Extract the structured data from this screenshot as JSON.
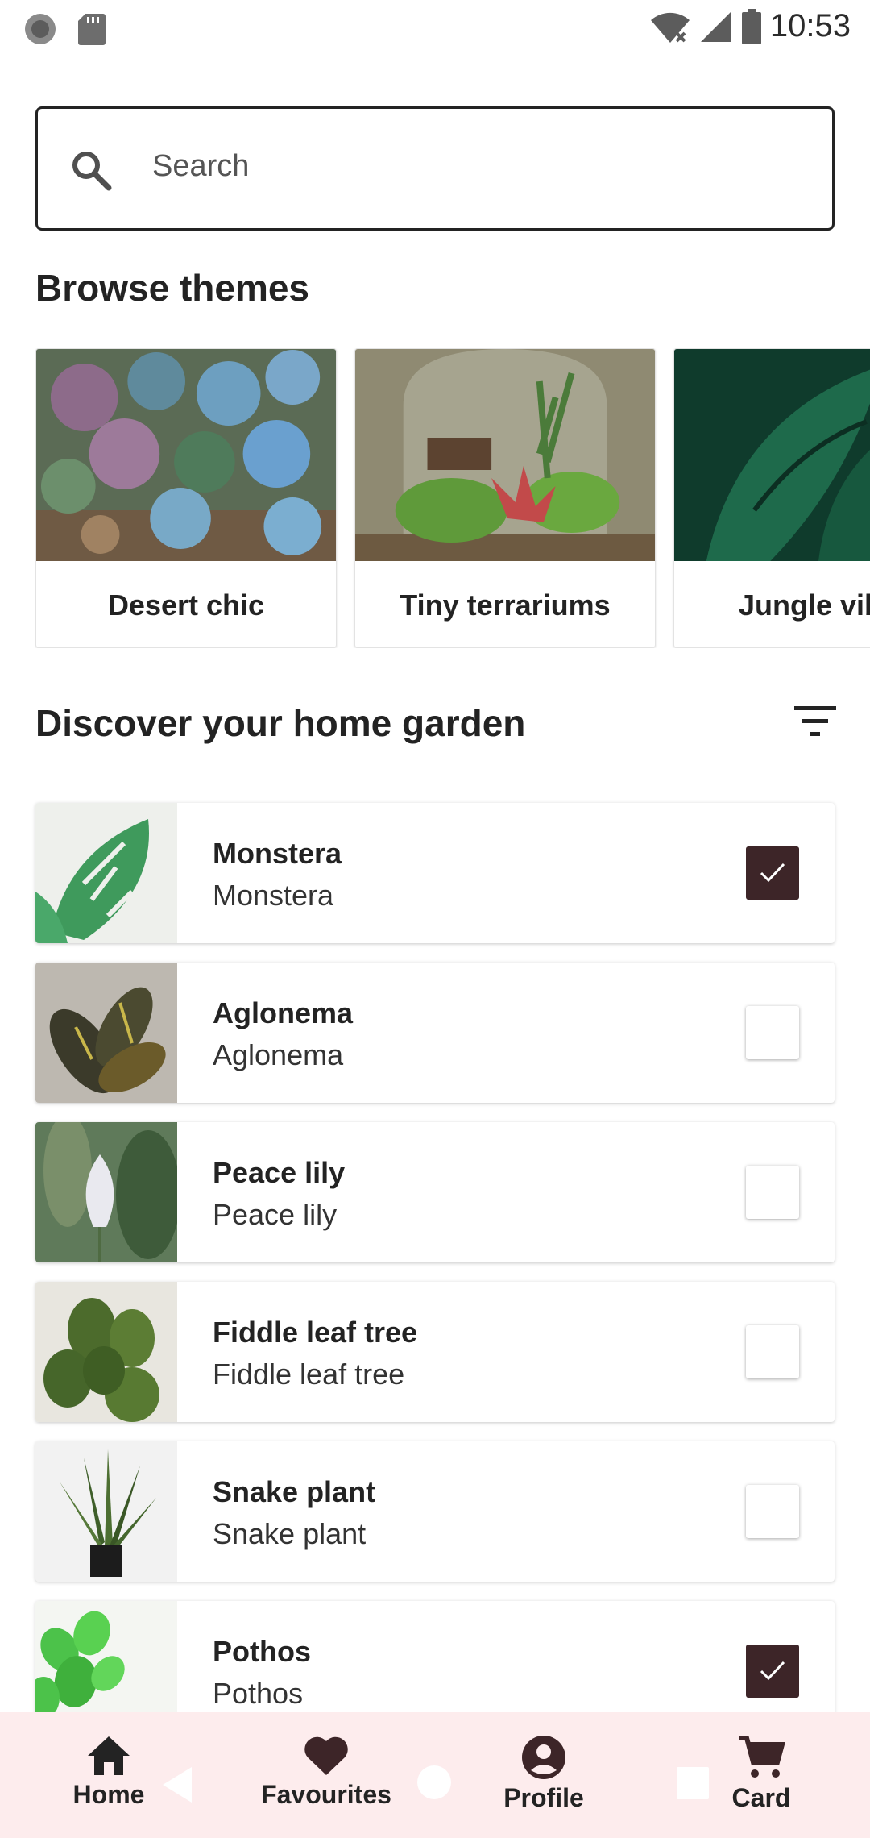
{
  "status_bar": {
    "time": "10:53"
  },
  "search": {
    "placeholder": "Search"
  },
  "browse": {
    "title": "Browse themes",
    "themes": [
      {
        "label": "Desert chic"
      },
      {
        "label": "Tiny terrariums"
      },
      {
        "label": "Jungle vib"
      }
    ]
  },
  "discover": {
    "title": "Discover your home garden",
    "plants": [
      {
        "name": "Monstera",
        "subtitle": "Monstera",
        "checked": true
      },
      {
        "name": "Aglonema",
        "subtitle": "Aglonema",
        "checked": false
      },
      {
        "name": "Peace lily",
        "subtitle": "Peace lily",
        "checked": false
      },
      {
        "name": "Fiddle leaf tree",
        "subtitle": "Fiddle leaf tree",
        "checked": false
      },
      {
        "name": "Snake plant",
        "subtitle": "Snake plant",
        "checked": false
      },
      {
        "name": "Pothos",
        "subtitle": "Pothos",
        "checked": true
      }
    ]
  },
  "nav": {
    "items": [
      {
        "label": "Home",
        "icon": "home-icon"
      },
      {
        "label": "Favourites",
        "icon": "heart-icon"
      },
      {
        "label": "Profile",
        "icon": "account-icon"
      },
      {
        "label": "Card",
        "icon": "cart-icon"
      }
    ]
  },
  "colors": {
    "accent": "#3d2528",
    "nav_bg": "#fdeced",
    "text": "#232323"
  }
}
